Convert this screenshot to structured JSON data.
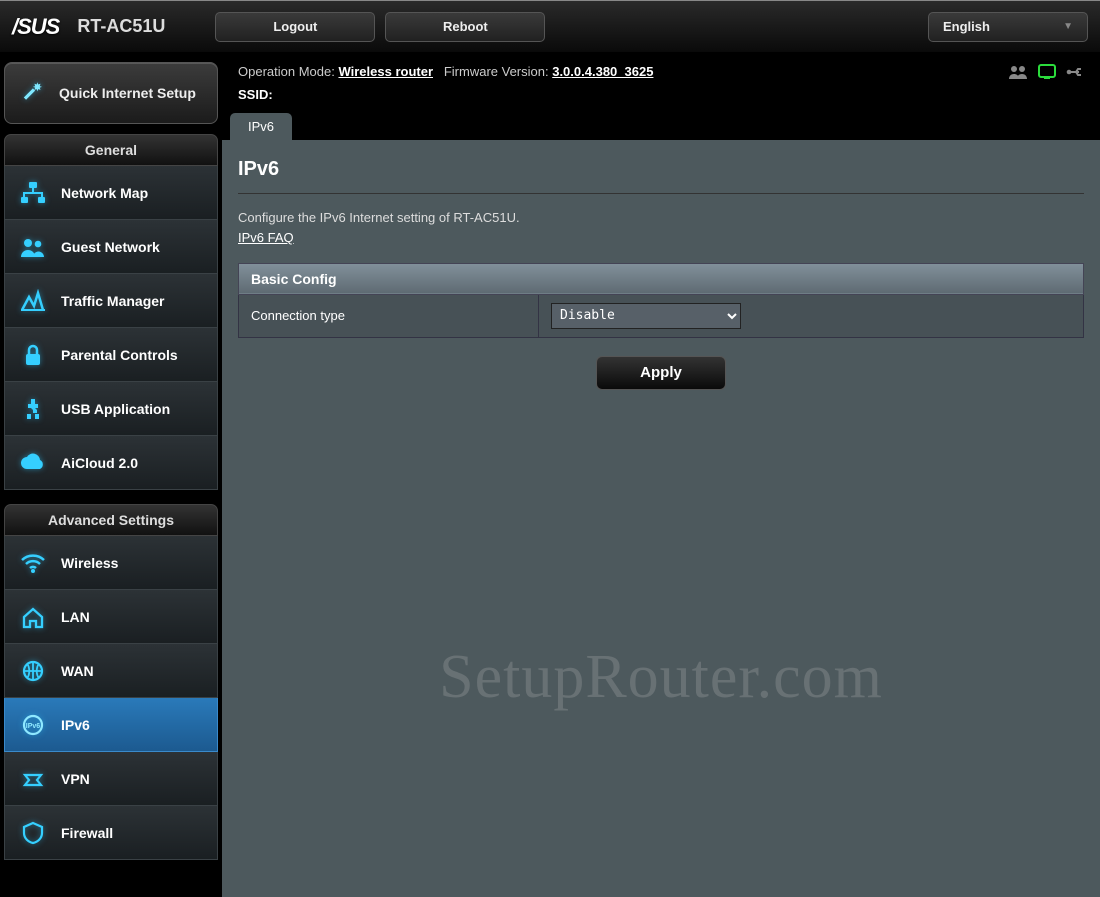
{
  "header": {
    "brand": "/SUS",
    "model": "RT-AC51U",
    "logout": "Logout",
    "reboot": "Reboot",
    "language": "English"
  },
  "info": {
    "op_mode_label": "Operation Mode:",
    "op_mode_value": "Wireless router",
    "fw_label": "Firmware Version:",
    "fw_value": "3.0.0.4.380_3625",
    "ssid_label": "SSID:"
  },
  "sidebar": {
    "qis": "Quick Internet Setup",
    "general_header": "General",
    "general": [
      {
        "id": "network-map",
        "label": "Network Map"
      },
      {
        "id": "guest-network",
        "label": "Guest Network"
      },
      {
        "id": "traffic-manager",
        "label": "Traffic Manager"
      },
      {
        "id": "parental-controls",
        "label": "Parental Controls"
      },
      {
        "id": "usb-application",
        "label": "USB Application"
      },
      {
        "id": "aicloud",
        "label": "AiCloud 2.0"
      }
    ],
    "advanced_header": "Advanced Settings",
    "advanced": [
      {
        "id": "wireless",
        "label": "Wireless"
      },
      {
        "id": "lan",
        "label": "LAN"
      },
      {
        "id": "wan",
        "label": "WAN"
      },
      {
        "id": "ipv6",
        "label": "IPv6",
        "active": true
      },
      {
        "id": "vpn",
        "label": "VPN"
      },
      {
        "id": "firewall",
        "label": "Firewall"
      }
    ]
  },
  "tabs": {
    "ipv6": "IPv6"
  },
  "page": {
    "title": "IPv6",
    "description": "Configure the IPv6 Internet setting of RT-AC51U.",
    "faq_link": "IPv6 FAQ",
    "section_title": "Basic Config",
    "conn_type_label": "Connection type",
    "conn_type_value": "Disable",
    "apply": "Apply"
  },
  "watermark": "SetupRouter.com"
}
